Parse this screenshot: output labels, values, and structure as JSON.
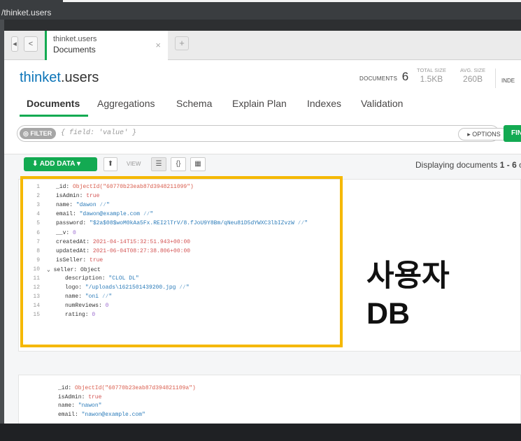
{
  "window": {
    "title": "/thinket.users"
  },
  "tab": {
    "subtitle": "thinket.users",
    "title": "Documents",
    "close": "×",
    "new": "+"
  },
  "nav": {
    "back": "<",
    "prev": "◂"
  },
  "namespace": {
    "db": "thinket",
    "collection": ".users"
  },
  "stats": {
    "documents_label": "DOCUMENTS",
    "documents_count": "6",
    "total_size_label": "TOTAL SIZE",
    "total_size": "1.5KB",
    "avg_size_label": "AVG. SIZE",
    "avg_size": "260B",
    "indexes_label": "INDE"
  },
  "tabs": [
    "Documents",
    "Aggregations",
    "Schema",
    "Explain Plan",
    "Indexes",
    "Validation"
  ],
  "filter": {
    "label": "FILTER",
    "placeholder": "{ field: 'value' }",
    "options": "▸ OPTIONS",
    "find": "FIN"
  },
  "toolbar": {
    "add_data": "ADD DATA",
    "view_label": "VIEW",
    "export_icon": "⬆",
    "list_icon": "☰",
    "json_icon": "{}",
    "table_icon": "▦",
    "display_prefix": "Displaying documents ",
    "display_range": "1 - 6",
    "display_suffix": " o"
  },
  "doc1": [
    {
      "n": "1",
      "f": "_id:",
      "v": " ObjectId(\"60770b23eab87d3948211099\")",
      "c": "oid"
    },
    {
      "n": "2",
      "f": "isAdmin:",
      "v": " true",
      "c": "bool"
    },
    {
      "n": "3",
      "f": "name:",
      "v": " \"dawon ⁄⁄\"",
      "c": "str"
    },
    {
      "n": "4",
      "f": "email:",
      "v": " \"dawon@example.com ⁄⁄\"",
      "c": "str"
    },
    {
      "n": "5",
      "f": "password:",
      "v": " \"$2a$08$woM0kAa5Fx.REI2lTrV/8.fJoU9Y8Bm/qNeu81D5dYWXC3lbIZvzW ⁄⁄\"",
      "c": "str"
    },
    {
      "n": "6",
      "f": "__v:",
      "v": " 0",
      "c": "num"
    },
    {
      "n": "7",
      "f": "createdAt:",
      "v": " 2021-04-14T15:32:51.943+00:00",
      "c": "dt"
    },
    {
      "n": "8",
      "f": "updatedAt:",
      "v": " 2021-06-04T08:27:38.806+00:00",
      "c": "dt"
    },
    {
      "n": "9",
      "f": "isSeller:",
      "v": " true",
      "c": "bool"
    },
    {
      "n": "10",
      "f": "⌄ seller:",
      "v": " Object",
      "c": "fld"
    },
    {
      "n": "11",
      "f": "description:",
      "v": " \"CLOL DL\"",
      "c": "str"
    },
    {
      "n": "12",
      "f": "logo:",
      "v": " \"/uploads\\1621501439200.jpg ⁄⁄\"",
      "c": "str"
    },
    {
      "n": "13",
      "f": "name:",
      "v": " \"oni ⁄⁄\"",
      "c": "str"
    },
    {
      "n": "14",
      "f": "numReviews:",
      "v": " 0",
      "c": "num"
    },
    {
      "n": "15",
      "f": "rating:",
      "v": " 0",
      "c": "num"
    }
  ],
  "doc2": [
    {
      "f": "_id:",
      "v": " ObjectId(\"60770b23eab87d394821109a\")",
      "c": "oid"
    },
    {
      "f": "isAdmin:",
      "v": " true",
      "c": "bool"
    },
    {
      "f": "name:",
      "v": " \"nawon\"",
      "c": "str"
    },
    {
      "f": "email:",
      "v": " \"nawon@example.com\"",
      "c": "str"
    }
  ],
  "annotation": {
    "line1": "사용자",
    "line2": "DB",
    "color": "#f5b800"
  }
}
